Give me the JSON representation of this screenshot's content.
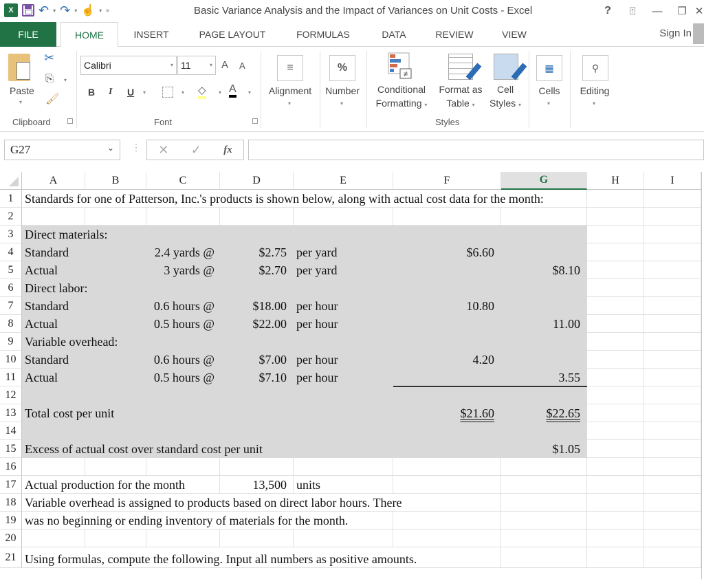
{
  "window": {
    "title": "Basic Variance Analysis and the Impact of Variances on Unit Costs - Excel",
    "controls": [
      "help-icon",
      "ribbon-display-icon",
      "minimize-icon",
      "restore-icon",
      "close-icon"
    ]
  },
  "quick_access": {
    "icons": [
      "excel-logo-icon",
      "save-icon",
      "undo-icon",
      "redo-icon",
      "touch-mode-icon",
      "customize-qat-icon"
    ]
  },
  "tabs": [
    {
      "label": "FILE"
    },
    {
      "label": "HOME",
      "active": true
    },
    {
      "label": "INSERT"
    },
    {
      "label": "PAGE LAYOUT"
    },
    {
      "label": "FORMULAS"
    },
    {
      "label": "DATA"
    },
    {
      "label": "REVIEW"
    },
    {
      "label": "VIEW"
    }
  ],
  "sign_in": "Sign In",
  "ribbon": {
    "clipboard": {
      "label": "Clipboard",
      "paste": "Paste"
    },
    "font": {
      "label": "Font",
      "font_name": "Calibri",
      "font_size": "11",
      "bold": "B",
      "italic": "I",
      "underline": "U",
      "grow": "A",
      "shrink": "A",
      "font_color_letter": "A"
    },
    "alignment": {
      "label": "Alignment",
      "icon": "≡"
    },
    "number": {
      "label": "Number",
      "icon": "%"
    },
    "styles": {
      "label": "Styles",
      "conditional_formatting": [
        "Conditional",
        "Formatting"
      ],
      "format_as_table": [
        "Format as",
        "Table"
      ],
      "cell_styles": [
        "Cell",
        "Styles"
      ]
    },
    "cells": {
      "label": "Cells"
    },
    "editing": {
      "label": "Editing"
    }
  },
  "formula_bar": {
    "name_box": "G27",
    "cancel": "✕",
    "enter": "✓",
    "fx": "fx",
    "formula": ""
  },
  "sheet": {
    "columns": [
      "A",
      "B",
      "C",
      "D",
      "E",
      "F",
      "G",
      "H",
      "I"
    ],
    "selected_column": "G",
    "rows": [
      "1",
      "2",
      "3",
      "4",
      "5",
      "6",
      "7",
      "8",
      "9",
      "10",
      "11",
      "12",
      "13",
      "14",
      "15",
      "16",
      "17",
      "18",
      "19",
      "20",
      "21"
    ],
    "cells": {
      "A1": "Standards for one of Patterson, Inc.'s products is shown below, along with actual cost data for the month:",
      "A3": "Direct materials:",
      "A4": "Standard",
      "C4": "2.4 yards @",
      "D4": "$2.75",
      "E4": "per yard",
      "F4": "$6.60",
      "A5": "Actual",
      "C5": "3 yards @",
      "D5": "$2.70",
      "E5": "per yard",
      "G5": "$8.10",
      "A6": "Direct labor:",
      "A7": "Standard",
      "C7": "0.6 hours @",
      "D7": "$18.00",
      "E7": "per hour",
      "F7": "10.80",
      "A8": "Actual",
      "C8": "0.5 hours @",
      "D8": "$22.00",
      "E8": "per hour",
      "G8": "11.00",
      "A9": "Variable overhead:",
      "A10": "Standard",
      "C10": "0.6 hours @",
      "D10": "$7.00",
      "E10": "per hour",
      "F10": "4.20",
      "A11": "Actual",
      "C11": "0.5 hours @",
      "D11": "$7.10",
      "E11": "per hour",
      "G11": "3.55",
      "A13": "Total cost per unit",
      "F13": "$21.60",
      "G13": "$22.65",
      "A15": "Excess of actual cost over standard cost per unit",
      "G15": "$1.05",
      "A17": "Actual production for the month",
      "D17": "13,500",
      "E17": "units",
      "A18": "Variable overhead is assigned to products based on direct labor hours. There",
      "A19": "was no beginning or ending inventory of materials for the month.",
      "A21": "Using formulas, compute the following.  Input all numbers as positive amounts."
    }
  }
}
